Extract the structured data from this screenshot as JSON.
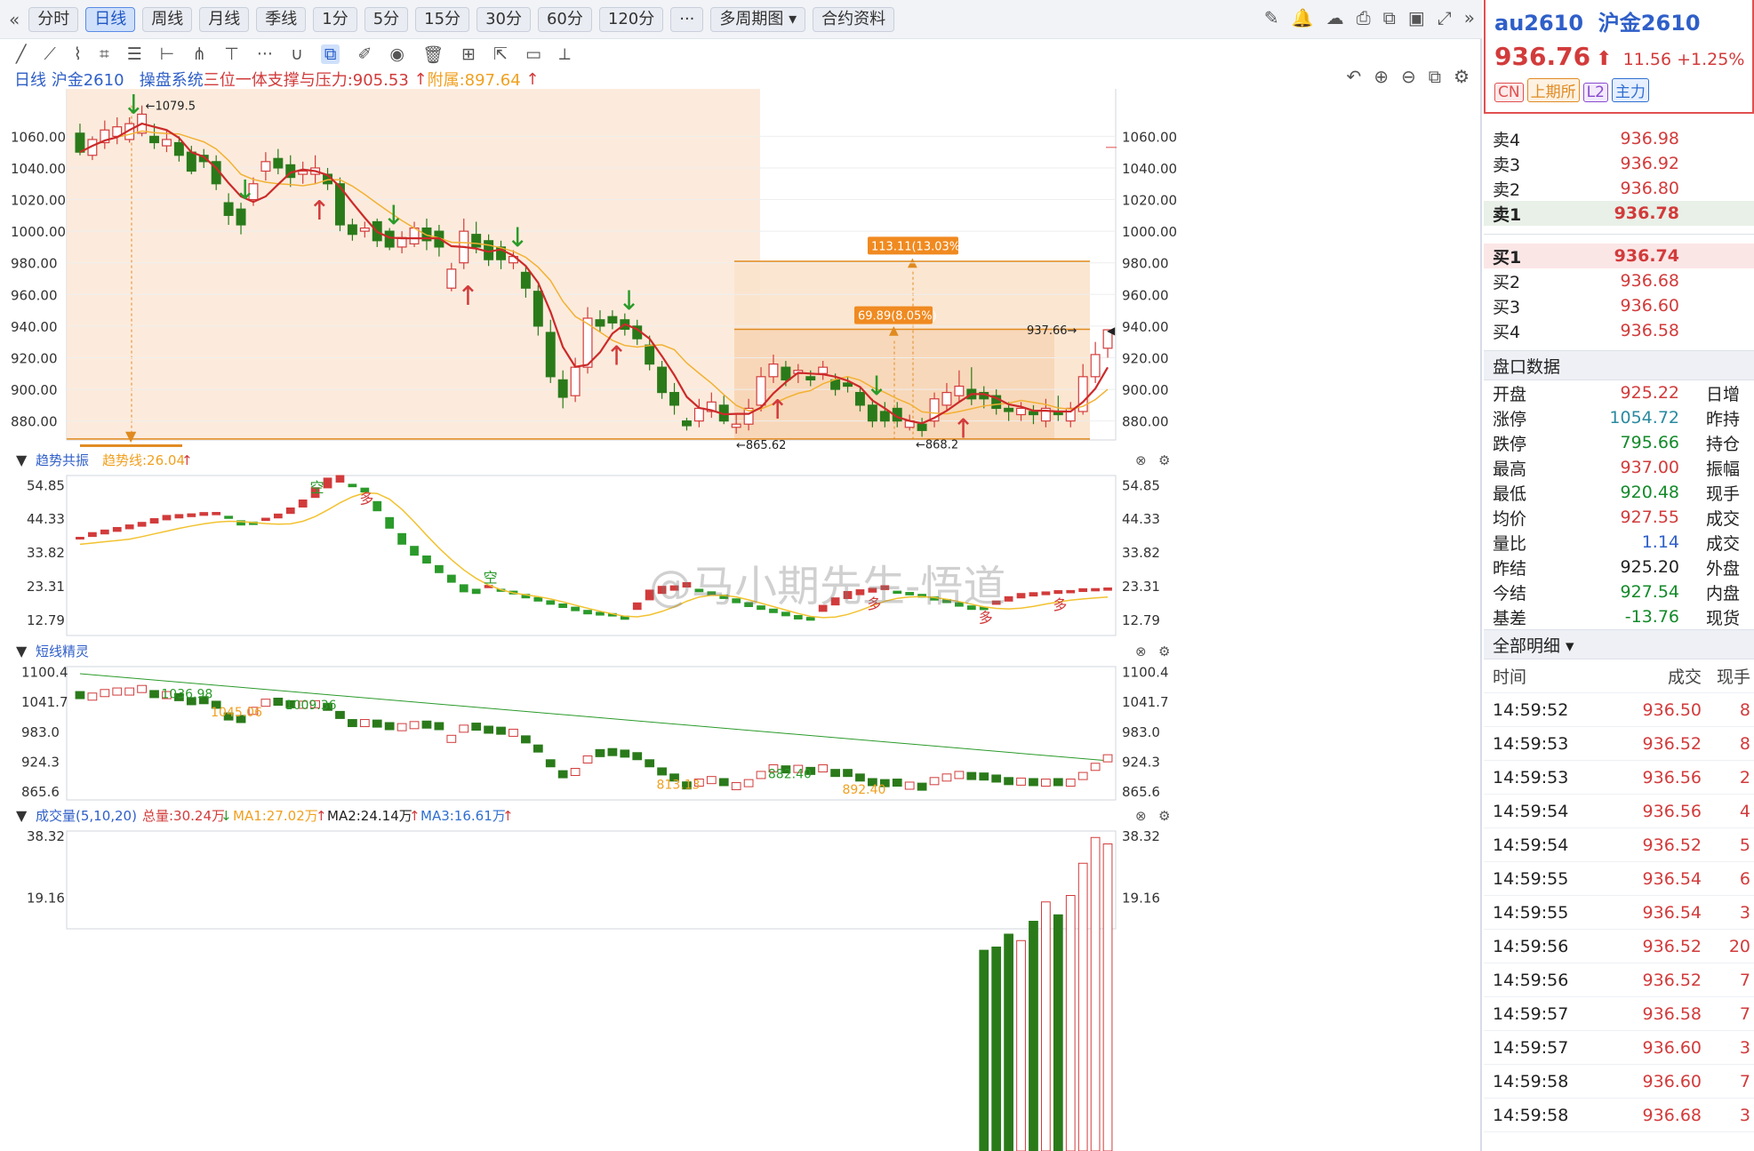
{
  "toolbar": {
    "items": [
      "分时",
      "日线",
      "周线",
      "月线",
      "季线",
      "1分",
      "5分",
      "15分",
      "30分",
      "60分",
      "120分",
      "···",
      "多周期图 ▾",
      "合约资料"
    ],
    "active_index": 1
  },
  "chart_header": {
    "period": "日线",
    "name": "沪金2610",
    "system_label": "操盘系统",
    "system_text": "三位一体支撑与压力:905.53",
    "attach_label": "附属:897.64"
  },
  "quote": {
    "code": "au2610",
    "name": "沪金2610",
    "price": "936.76",
    "change": "11.56",
    "pct": "+1.25%",
    "tags": [
      "CN",
      "上期所",
      "L2",
      "主力"
    ]
  },
  "book": {
    "sells": [
      {
        "label": "卖4",
        "price": "936.98"
      },
      {
        "label": "卖3",
        "price": "936.92"
      },
      {
        "label": "卖2",
        "price": "936.80"
      },
      {
        "label": "卖1",
        "price": "936.78"
      }
    ],
    "buys": [
      {
        "label": "买1",
        "price": "936.74"
      },
      {
        "label": "买2",
        "price": "936.68"
      },
      {
        "label": "买3",
        "price": "936.60"
      },
      {
        "label": "买4",
        "price": "936.58"
      }
    ]
  },
  "panel": {
    "title": "盘口数据",
    "rows": [
      {
        "label": "开盘",
        "value": "925.22",
        "extra": "日增"
      },
      {
        "label": "涨停",
        "value": "1054.72",
        "extra": "昨持"
      },
      {
        "label": "跌停",
        "value": "795.66",
        "extra": "持仓"
      },
      {
        "label": "最高",
        "value": "937.00",
        "extra": "振幅"
      },
      {
        "label": "最低",
        "value": "920.48",
        "extra": "现手"
      },
      {
        "label": "均价",
        "value": "927.55",
        "extra": "成交"
      },
      {
        "label": "量比",
        "value": "1.14",
        "extra": "成交"
      },
      {
        "label": "昨结",
        "value": "925.20",
        "extra": "外盘"
      },
      {
        "label": "今结",
        "value": "927.54",
        "extra": "内盘"
      },
      {
        "label": "基差",
        "value": "-13.76",
        "extra": "现货"
      }
    ]
  },
  "ticks": {
    "title": "全部明细 ▾",
    "headers": [
      "时间",
      "成交",
      "现手"
    ],
    "rows": [
      [
        "14:59:52",
        "936.50",
        "8"
      ],
      [
        "14:59:53",
        "936.52",
        "8"
      ],
      [
        "14:59:53",
        "936.56",
        "2"
      ],
      [
        "14:59:54",
        "936.56",
        "4"
      ],
      [
        "14:59:54",
        "936.52",
        "5"
      ],
      [
        "14:59:55",
        "936.54",
        "6"
      ],
      [
        "14:59:55",
        "936.54",
        "3"
      ],
      [
        "14:59:56",
        "936.52",
        "20"
      ],
      [
        "14:59:56",
        "936.52",
        "7"
      ],
      [
        "14:59:57",
        "936.58",
        "7"
      ],
      [
        "14:59:57",
        "936.60",
        "3"
      ],
      [
        "14:59:58",
        "936.60",
        "7"
      ],
      [
        "14:59:58",
        "936.68",
        "3"
      ]
    ]
  },
  "indicators": {
    "trend": {
      "title": "趋势共振",
      "line_label": "趋势线:26.04"
    },
    "short": {
      "title": "短线精灵"
    },
    "volume": {
      "title": "成交量(5,10,20)",
      "total": "总量:30.24万",
      "ma1": "MA1:27.02万",
      "ma2": "MA2:24.14万",
      "ma3": "MA3:16.61万"
    }
  },
  "watermark": "@马小期先生-悟道",
  "chart_data": {
    "type": "candlestick",
    "y_ticks": [
      880,
      900,
      920,
      940,
      960,
      980,
      1000,
      1020,
      1040,
      1060
    ],
    "y_tick_labels": [
      "880.00",
      "900.00",
      "920.00",
      "940.00",
      "960.00",
      "980.00",
      "1000.00",
      "1020.00",
      "1040.00",
      "1060.00"
    ],
    "ylim": [
      868,
      1090
    ],
    "candles": [
      [
        1062,
        1050,
        1068,
        1048
      ],
      [
        1048,
        1058,
        1060,
        1045
      ],
      [
        1056,
        1064,
        1070,
        1052
      ],
      [
        1060,
        1066,
        1072,
        1055
      ],
      [
        1058,
        1068,
        1072,
        1056
      ],
      [
        1062,
        1074,
        1079.5,
        1060
      ],
      [
        1060,
        1056,
        1068,
        1052
      ],
      [
        1054,
        1058,
        1064,
        1050
      ],
      [
        1056,
        1048,
        1060,
        1044
      ],
      [
        1050,
        1038,
        1054,
        1036
      ],
      [
        1048,
        1044,
        1052,
        1040
      ],
      [
        1044,
        1030,
        1048,
        1026
      ],
      [
        1018,
        1010,
        1024,
        1004
      ],
      [
        1014,
        1004,
        1018,
        998
      ],
      [
        1020,
        1030,
        1034,
        1016
      ],
      [
        1038,
        1044,
        1050,
        1032
      ],
      [
        1046,
        1040,
        1052,
        1036
      ],
      [
        1042,
        1034,
        1048,
        1028
      ],
      [
        1036,
        1038,
        1044,
        1030
      ],
      [
        1036,
        1040,
        1048,
        1030
      ],
      [
        1036,
        1030,
        1040,
        1026
      ],
      [
        1030,
        1004,
        1034,
        1000
      ],
      [
        1004,
        998,
        1008,
        994
      ],
      [
        1000,
        1002,
        1006,
        996
      ],
      [
        1006,
        994,
        1008,
        990
      ],
      [
        1000,
        990,
        1002,
        988
      ],
      [
        990,
        996,
        1000,
        986
      ],
      [
        992,
        1002,
        1006,
        990
      ],
      [
        1002,
        994,
        1008,
        988
      ],
      [
        1000,
        990,
        1004,
        984
      ],
      [
        964,
        976,
        980,
        962
      ],
      [
        980,
        1000,
        1008,
        976
      ],
      [
        998,
        990,
        1006,
        986
      ],
      [
        994,
        982,
        998,
        978
      ],
      [
        990,
        982,
        994,
        976
      ],
      [
        980,
        984,
        988,
        976
      ],
      [
        974,
        964,
        978,
        958
      ],
      [
        962,
        940,
        966,
        934
      ],
      [
        936,
        908,
        944,
        904
      ],
      [
        906,
        895,
        912,
        888
      ],
      [
        896,
        914,
        920,
        892
      ],
      [
        914,
        945,
        952,
        910
      ],
      [
        944,
        940,
        950,
        936
      ],
      [
        946,
        942,
        950,
        938
      ],
      [
        944,
        938,
        948,
        934
      ],
      [
        940,
        932,
        944,
        928
      ],
      [
        928,
        916,
        934,
        912
      ],
      [
        914,
        898,
        918,
        894
      ],
      [
        898,
        890,
        904,
        884
      ],
      [
        880,
        877,
        882,
        874
      ],
      [
        880,
        888,
        894,
        876
      ],
      [
        886,
        892,
        898,
        882
      ],
      [
        890,
        880,
        896,
        878
      ],
      [
        876,
        878,
        884,
        872
      ],
      [
        878,
        888,
        894,
        874
      ],
      [
        890,
        908,
        914,
        886
      ],
      [
        908,
        916,
        922,
        904
      ],
      [
        914,
        906,
        918,
        902
      ],
      [
        910,
        912,
        916,
        904
      ],
      [
        908,
        906,
        912,
        902
      ],
      [
        910,
        914,
        918,
        906
      ],
      [
        906,
        900,
        910,
        896
      ],
      [
        904,
        902,
        908,
        898
      ],
      [
        898,
        890,
        902,
        886
      ],
      [
        890,
        880,
        894,
        876
      ],
      [
        886,
        880,
        892,
        876
      ],
      [
        888,
        880,
        892,
        876
      ],
      [
        876,
        880,
        884,
        874
      ],
      [
        878,
        874,
        882,
        870
      ],
      [
        880,
        894,
        898,
        876
      ],
      [
        890,
        898,
        904,
        886
      ],
      [
        896,
        902,
        912,
        892
      ],
      [
        900,
        894,
        914,
        890
      ],
      [
        898,
        894,
        902,
        888
      ],
      [
        896,
        888,
        900,
        884
      ],
      [
        888,
        886,
        892,
        880
      ],
      [
        884,
        888,
        892,
        880
      ],
      [
        886,
        884,
        890,
        878
      ],
      [
        880,
        888,
        894,
        876
      ],
      [
        886,
        884,
        896,
        880
      ],
      [
        880,
        888,
        892,
        876
      ],
      [
        886,
        908,
        916,
        884
      ],
      [
        908,
        922,
        930,
        904
      ],
      [
        926,
        937.66,
        938,
        920
      ]
    ],
    "annotations": [
      "1079.5",
      "865.62",
      "868.2",
      "937.66",
      "113.11(13.03%)",
      "69.89(8.05%)"
    ],
    "trend_ticks": [
      "12.79",
      "23.31",
      "33.82",
      "44.33",
      "54.85"
    ],
    "short_ticks": [
      "865.6",
      "924.3",
      "983.0",
      "1041.7",
      "1100.4"
    ],
    "short_labels": [
      "1036.98",
      "1045.06",
      "1009.36",
      "813.13",
      "882.40",
      "892.40"
    ],
    "vol_ticks": [
      "19.16",
      "38.32"
    ]
  }
}
